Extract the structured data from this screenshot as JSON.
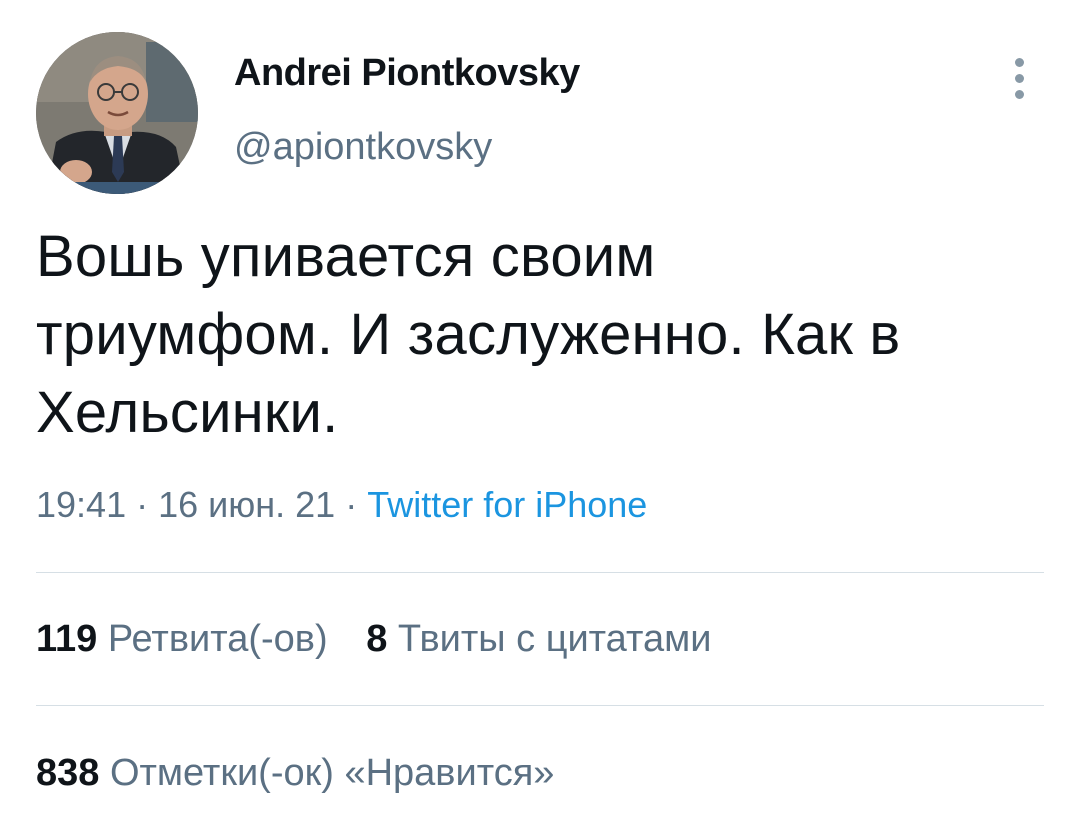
{
  "author": {
    "display_name": "Andrei Piontkovsky",
    "handle": "@apiontkovsky",
    "avatar_icon": "profile-photo"
  },
  "tweet": {
    "text_line1": "Вошь упивается своим",
    "text_line2": "триумфом. И заслуженно. Как в",
    "text_line3": "Хельсинки."
  },
  "meta": {
    "time": "19:41",
    "sep1": " · ",
    "date": "16 июн. 21",
    "sep2": " · ",
    "source": "Twitter for iPhone"
  },
  "stats": {
    "retweets_count": "119",
    "retweets_label": "Ретвита(-ов)",
    "quotes_count": "8",
    "quotes_label": "Твиты с цитатами",
    "likes_count": "838",
    "likes_label": "Отметки(-ок) «Нравится»"
  },
  "colors": {
    "text": "#0f1419",
    "secondary": "#5b7083",
    "link": "#1b95e0",
    "divider": "#d6dfe5"
  }
}
